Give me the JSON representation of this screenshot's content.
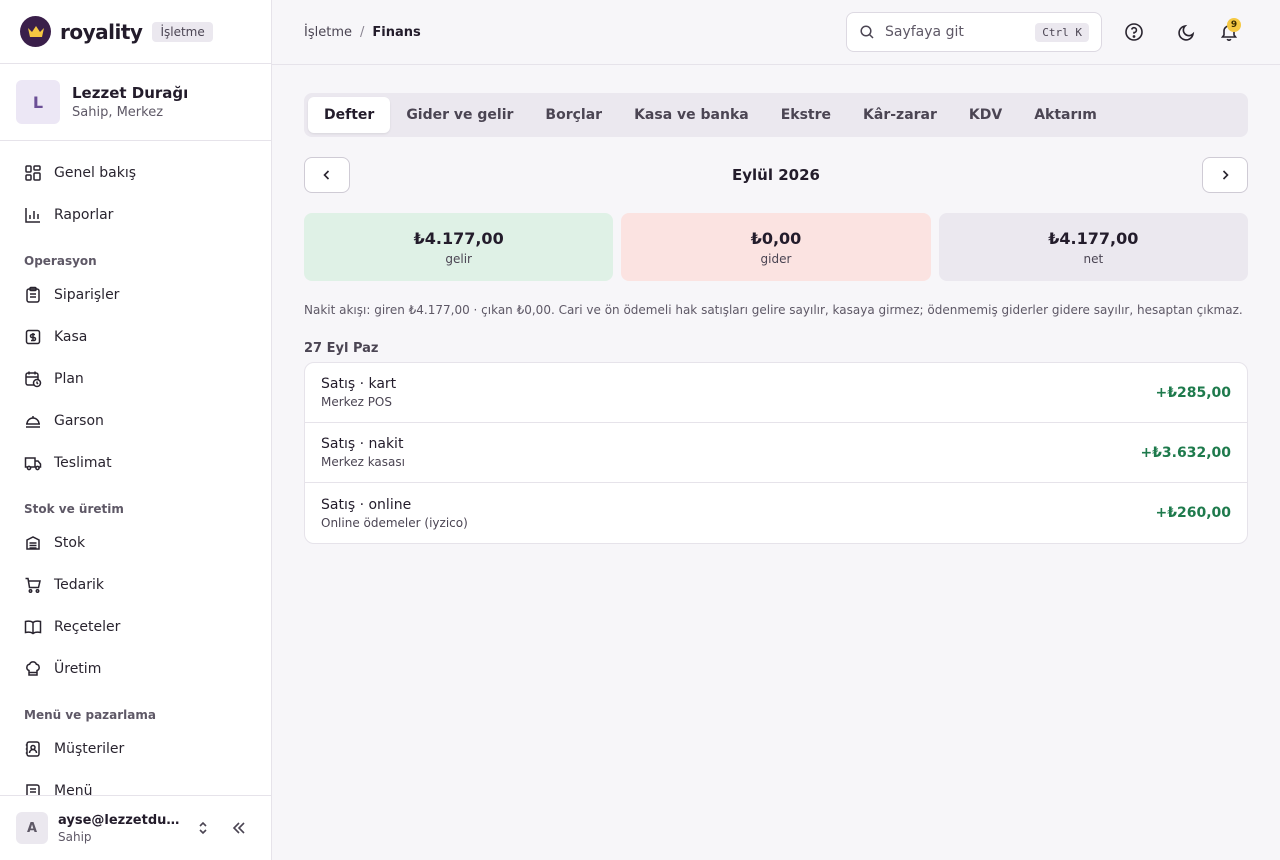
{
  "brand": {
    "name": "royality",
    "badge": "İşletme"
  },
  "org": {
    "initial": "L",
    "name": "Lezzet Durağı",
    "subtitle": "Sahip, Merkez"
  },
  "nav": {
    "top": [
      {
        "label": "Genel bakış",
        "icon": "grid-icon"
      },
      {
        "label": "Raporlar",
        "icon": "bar-chart-icon"
      }
    ],
    "sections": [
      {
        "title": "Operasyon",
        "items": [
          {
            "label": "Siparişler",
            "icon": "clipboard-icon"
          },
          {
            "label": "Kasa",
            "icon": "cash-register-icon"
          },
          {
            "label": "Plan",
            "icon": "calendar-clock-icon"
          },
          {
            "label": "Garson",
            "icon": "waiter-icon"
          },
          {
            "label": "Teslimat",
            "icon": "truck-icon"
          }
        ]
      },
      {
        "title": "Stok ve üretim",
        "items": [
          {
            "label": "Stok",
            "icon": "stack-icon"
          },
          {
            "label": "Tedarik",
            "icon": "cart-icon"
          },
          {
            "label": "Reçeteler",
            "icon": "book-icon"
          },
          {
            "label": "Üretim",
            "icon": "chef-hat-icon"
          }
        ]
      },
      {
        "title": "Menü ve pazarlama",
        "items": [
          {
            "label": "Müşteriler",
            "icon": "contact-icon"
          },
          {
            "label": "Menü",
            "icon": "menu-book-icon"
          }
        ]
      }
    ]
  },
  "user": {
    "initial": "A",
    "email": "ayse@lezzetdurağı.com",
    "role": "Sahip"
  },
  "header": {
    "breadcrumb": [
      "İşletme",
      "Finans"
    ],
    "search_placeholder": "Sayfaya git",
    "search_shortcut": "Ctrl K",
    "notification_count": "9"
  },
  "tabs": [
    {
      "label": "Defter",
      "active": true
    },
    {
      "label": "Gider ve gelir"
    },
    {
      "label": "Borçlar"
    },
    {
      "label": "Kasa ve banka"
    },
    {
      "label": "Ekstre"
    },
    {
      "label": "Kâr-zarar"
    },
    {
      "label": "KDV"
    },
    {
      "label": "Aktarım"
    }
  ],
  "period": {
    "label": "Eylül 2026"
  },
  "summary": [
    {
      "value": "₺4.177,00",
      "label": "gelir",
      "color": "#dff1e6"
    },
    {
      "value": "₺0,00",
      "label": "gider",
      "color": "#fbe3e1"
    },
    {
      "value": "₺4.177,00",
      "label": "net",
      "color": "#ebe8ef"
    }
  ],
  "note": "Nakit akışı: giren ₺4.177,00 · çıkan ₺0,00. Cari ve ön ödemeli hak satışları gelire sayılır, kasaya girmez; ödenmemiş giderler gidere sayılır, hesaptan çıkmaz.",
  "ledger": {
    "date": "27 Eyl Paz",
    "rows": [
      {
        "title": "Satış · kart",
        "account": "Merkez POS",
        "amount": "+₺285,00"
      },
      {
        "title": "Satış · nakit",
        "account": "Merkez kasası",
        "amount": "+₺3.632,00"
      },
      {
        "title": "Satış · online",
        "account": "Online ödemeler (iyzico)",
        "amount": "+₺260,00"
      }
    ]
  },
  "colors": {
    "positive": "#1e7a4c",
    "brand_dark": "#3a1f4a",
    "brand_gold": "#f5c842"
  }
}
